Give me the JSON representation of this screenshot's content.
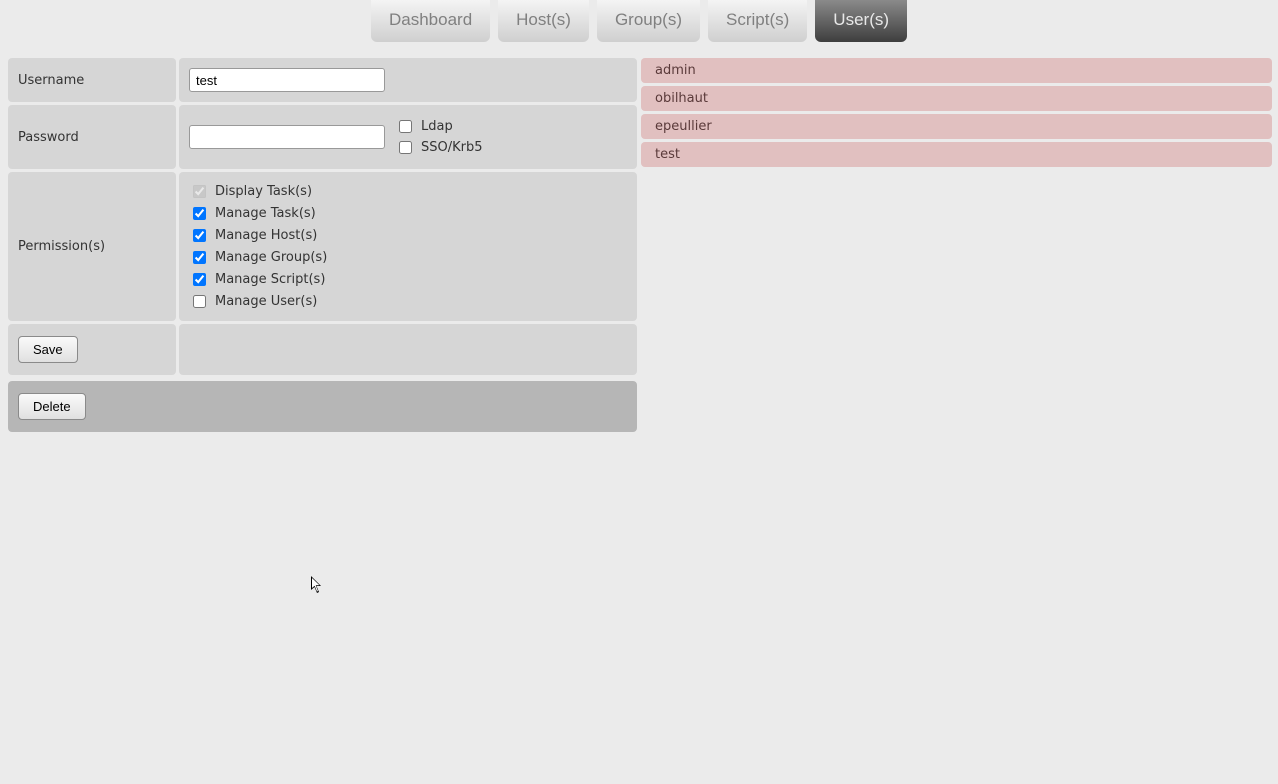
{
  "tabs": {
    "dashboard": "Dashboard",
    "hosts": "Host(s)",
    "groups": "Group(s)",
    "scripts": "Script(s)",
    "users": "User(s)"
  },
  "active_tab": "users",
  "form": {
    "labels": {
      "username": "Username",
      "password": "Password",
      "permission": "Permission(s)"
    },
    "username_value": "test",
    "password_value": "",
    "auth": {
      "ldap": {
        "label": "Ldap",
        "checked": false
      },
      "sso": {
        "label": "SSO/Krb5",
        "checked": false
      }
    },
    "permissions": [
      {
        "label": "Display Task(s)",
        "checked": true,
        "disabled": true
      },
      {
        "label": "Manage Task(s)",
        "checked": true,
        "disabled": false
      },
      {
        "label": "Manage Host(s)",
        "checked": true,
        "disabled": false
      },
      {
        "label": "Manage Group(s)",
        "checked": true,
        "disabled": false
      },
      {
        "label": "Manage Script(s)",
        "checked": true,
        "disabled": false
      },
      {
        "label": "Manage User(s)",
        "checked": false,
        "disabled": false
      }
    ],
    "buttons": {
      "save": "Save",
      "delete": "Delete"
    }
  },
  "user_list": [
    "admin",
    "obilhaut",
    "epeullier",
    "test"
  ]
}
